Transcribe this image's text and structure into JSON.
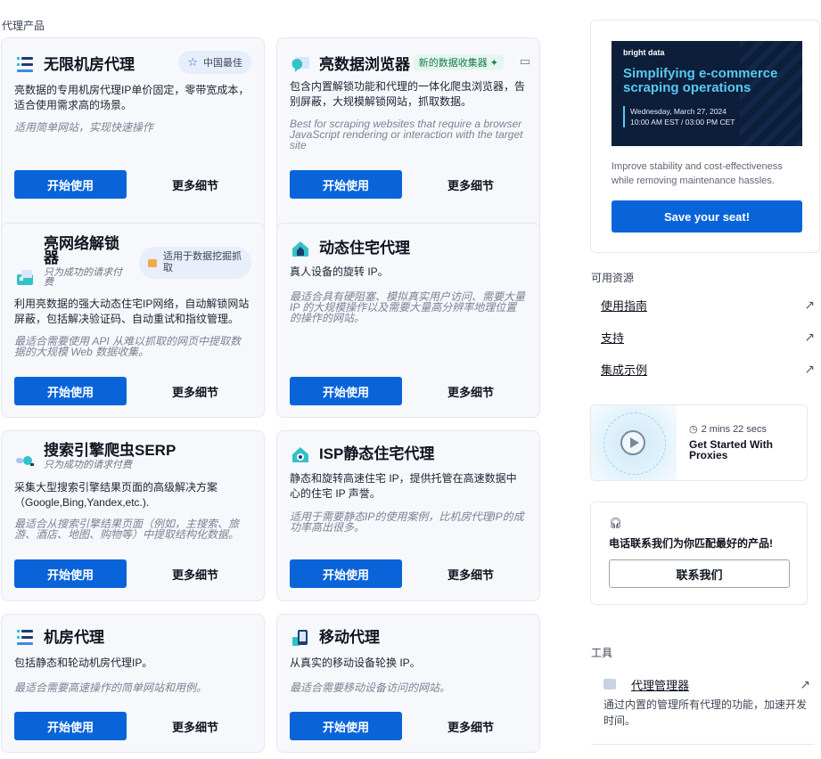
{
  "section_title": "代理产品",
  "products": [
    {
      "title": "无限机房代理",
      "subtitle": "",
      "badge": "中国最佳",
      "badge_icon": "star-icon",
      "desc": "亮数据的专用机房代理IP单价固定，零带宽成本，适合使用需求高的场景。",
      "best_for": "适用简单网站，实现快速操作",
      "start_label": "开始使用",
      "more_label": "更多细节"
    },
    {
      "title": "亮数据浏览器",
      "subtitle": "",
      "badge": "新的数据收集器 ✦",
      "badge_icon": "video-camera-icon",
      "desc": "包含内置解锁功能和代理的一体化爬虫浏览器，告别屏蔽，大规模解锁网站，抓取数据。",
      "best_for": "Best for scraping websites that require a browser JavaScript rendering or interaction with the target site",
      "start_label": "开始使用",
      "more_label": "更多细节"
    },
    {
      "title": "亮网络解锁器",
      "subtitle": "只为成功的请求付费",
      "badge": "适用于数据挖掘抓取",
      "badge_icon": "lock-icon",
      "desc": "利用亮数据的强大动态住宅IP网络，自动解锁网站屏蔽，包括解决验证码、自动重试和指纹管理。",
      "best_for": "最适合需要使用 API 从难以抓取的网页中提取数据的大规模 Web 数据收集。",
      "start_label": "开始使用",
      "more_label": "更多细节"
    },
    {
      "title": "动态住宅代理",
      "subtitle": "",
      "badge": "",
      "badge_icon": "",
      "desc": "真人设备的旋转 IP。",
      "best_for": "最适合具有硬阻塞、模拟真实用户访问、需要大量 IP 的大规模操作以及需要大量高分辨率地理位置的操作的网站。",
      "start_label": "开始使用",
      "more_label": "更多细节"
    },
    {
      "title": "搜索引擎爬虫SERP",
      "subtitle": "只为成功的请求付费",
      "badge": "",
      "badge_icon": "",
      "desc": "采集大型搜索引擎结果页面的高级解决方案（Google,Bing,Yandex,etc.).",
      "best_for": "最适合从搜索引擎结果页面（例如，主搜索、旅游、酒店、地图、购物等）中提取结构化数据。",
      "start_label": "开始使用",
      "more_label": "更多细节"
    },
    {
      "title": "ISP静态住宅代理",
      "subtitle": "",
      "badge": "",
      "badge_icon": "",
      "desc": "静态和旋转高速住宅 IP，提供托管在高速数据中心的住宅 IP 声誉。",
      "best_for": "适用于需要静态IP的使用案例，比机房代理IP的成功率高出很多。",
      "start_label": "开始使用",
      "more_label": "更多细节"
    },
    {
      "title": "机房代理",
      "subtitle": "",
      "badge": "",
      "badge_icon": "",
      "desc": "包括静态和轮动机房代理IP。",
      "best_for": "最适合需要高速操作的简单网站和用例。",
      "start_label": "开始使用",
      "more_label": "更多细节"
    },
    {
      "title": "移动代理",
      "subtitle": "",
      "badge": "",
      "badge_icon": "",
      "desc": "从真实的移动设备轮换 IP。",
      "best_for": "最适合需要移动设备访问的网站。",
      "start_label": "开始使用",
      "more_label": "更多细节"
    }
  ],
  "promo": {
    "logo": "bright data",
    "headline": "Simplifying e-commerce scraping operations",
    "date_line1": "Wednesday, March 27, 2024",
    "date_line2": "10:00 AM EST / 03:00 PM CET",
    "text": "Improve stability and cost-effectiveness while removing maintenance hassles.",
    "button": "Save your seat!"
  },
  "resources": {
    "title": "可用资源",
    "links": [
      "使用指南",
      "支持",
      "集成示例"
    ]
  },
  "video": {
    "duration": "2 mins 22 secs",
    "title": "Get Started With Proxies"
  },
  "contact": {
    "text": "电话联系我们为你匹配最好的产品!",
    "button": "联系我们"
  },
  "tools": {
    "title": "工具",
    "name": "代理管理器",
    "desc": "通过内置的管理所有代理的功能，加速开发时间。"
  },
  "colors": {
    "primary": "#0a64d9",
    "card_bg": "#f6f8fb",
    "banner_bg": "#0c1e3a",
    "banner_accent": "#5ac8f0"
  }
}
